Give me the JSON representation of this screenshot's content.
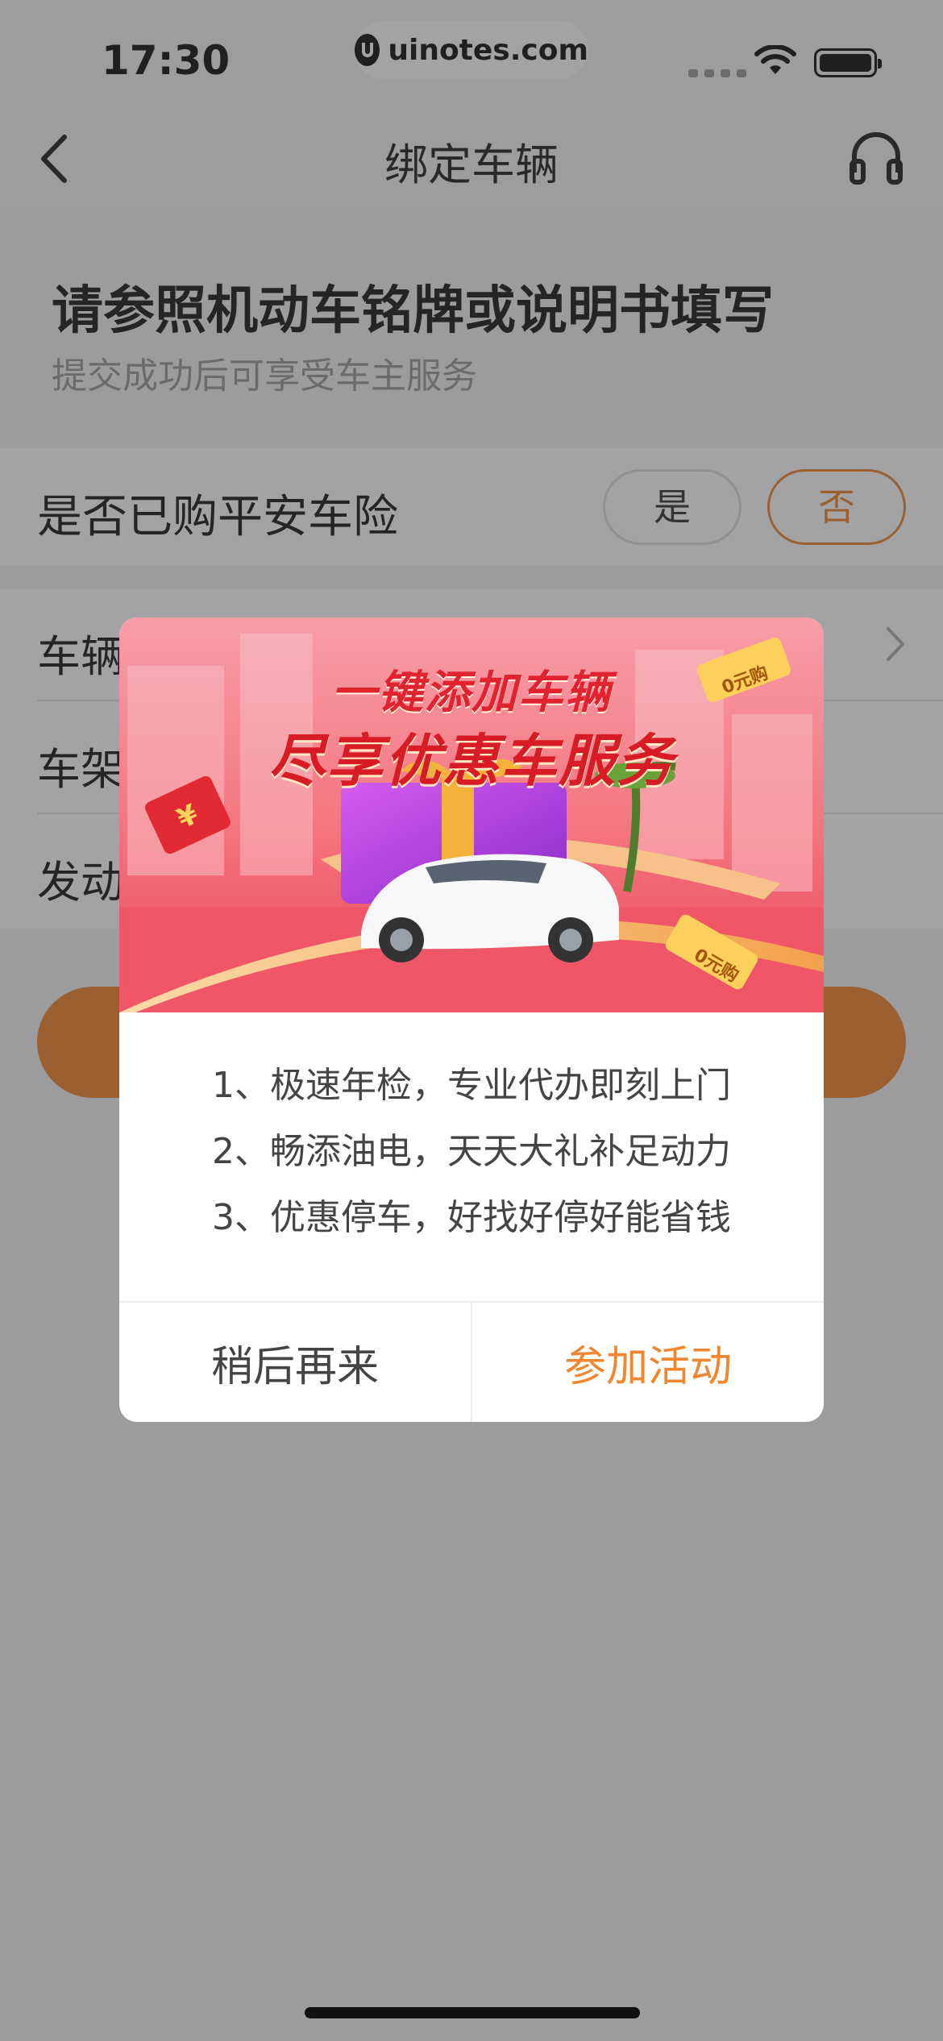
{
  "status_bar": {
    "time": "17:30",
    "url": "uinotes.com",
    "icons": [
      "signal-dots-icon",
      "wifi-icon",
      "battery-icon"
    ]
  },
  "nav": {
    "title": "绑定车辆",
    "back_icon": "chevron-left-icon",
    "support_icon": "headset-icon"
  },
  "intro": {
    "title": "请参照机动车铭牌或说明书填写",
    "subtitle": "提交成功后可享受车主服务"
  },
  "insurance": {
    "label": "是否已购平安车险",
    "options": [
      "是",
      "否"
    ],
    "selected": "否"
  },
  "form": {
    "rows": [
      {
        "label": "车辆"
      },
      {
        "label": "车架"
      },
      {
        "label": "发动"
      }
    ]
  },
  "dialog": {
    "banner_title_1": "一键添加车辆",
    "banner_title_2": "尽享优惠车服务",
    "banner_tags": [
      "0元购",
      "0元购"
    ],
    "benefits": [
      "1、极速年检，专业代办即刻上门",
      "2、畅添油电，天天大礼补足动力",
      "3、优惠停车，好找好停好能省钱"
    ],
    "later_label": "稍后再来",
    "join_label": "参加活动"
  },
  "colors": {
    "accent": "#f0862f",
    "mask": "rgba(50,50,55,0.45)",
    "banner_red": "#d71c25"
  }
}
